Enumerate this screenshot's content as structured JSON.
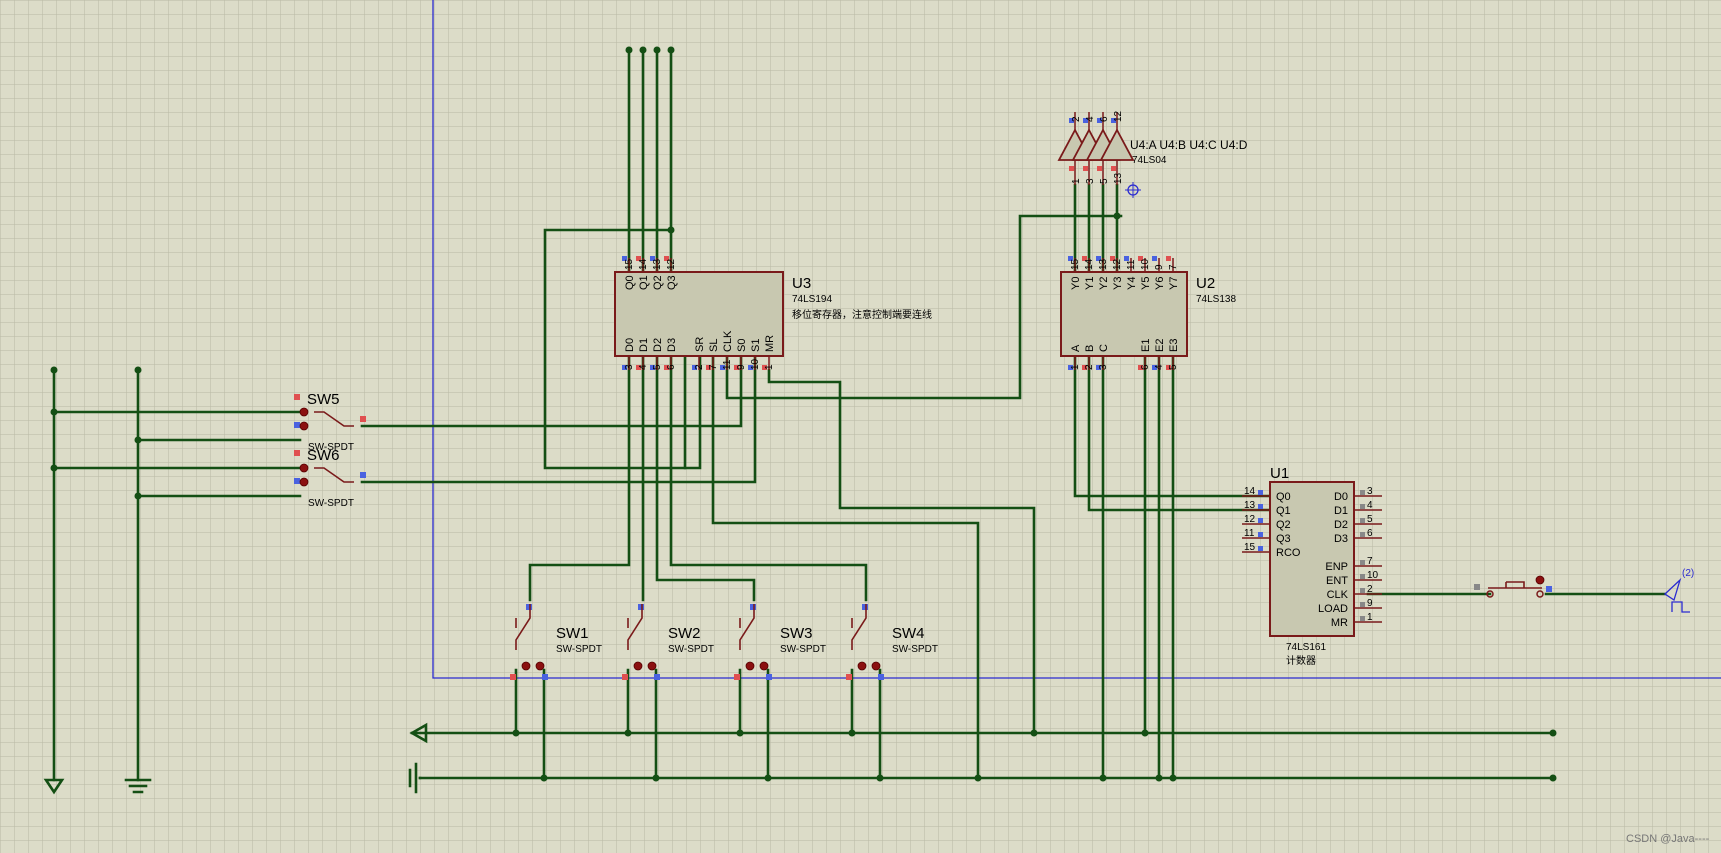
{
  "watermark": "CSDN @Java----",
  "u3": {
    "ref": "U3",
    "part": "74LS194",
    "desc": "移位寄存器，注意控制端要连线",
    "top": [
      {
        "l": "Q0",
        "n": "15"
      },
      {
        "l": "Q1",
        "n": "14"
      },
      {
        "l": "Q2",
        "n": "13"
      },
      {
        "l": "Q3",
        "n": "12"
      }
    ],
    "bottom": [
      {
        "l": "D0",
        "n": "3"
      },
      {
        "l": "D1",
        "n": "4"
      },
      {
        "l": "D2",
        "n": "5"
      },
      {
        "l": "D3",
        "n": "6"
      },
      {
        "l": "SR",
        "n": "2"
      },
      {
        "l": "SL",
        "n": "7"
      },
      {
        "l": "CLK",
        "n": "11"
      },
      {
        "l": "S0",
        "n": "9"
      },
      {
        "l": "S1",
        "n": "10"
      },
      {
        "l": "MR",
        "n": "1"
      }
    ]
  },
  "u2": {
    "ref": "U2",
    "part": "74LS138",
    "top": [
      {
        "l": "Y0",
        "n": "15"
      },
      {
        "l": "Y1",
        "n": "14"
      },
      {
        "l": "Y2",
        "n": "13"
      },
      {
        "l": "Y3",
        "n": "12"
      },
      {
        "l": "Y4",
        "n": "11"
      },
      {
        "l": "Y5",
        "n": "10"
      },
      {
        "l": "Y6",
        "n": "9"
      },
      {
        "l": "Y7",
        "n": "7"
      }
    ],
    "bottom": [
      {
        "l": "A",
        "n": "1"
      },
      {
        "l": "B",
        "n": "2"
      },
      {
        "l": "C",
        "n": "3"
      },
      {
        "l": "E1",
        "n": "6"
      },
      {
        "l": "E2",
        "n": "4"
      },
      {
        "l": "E3",
        "n": "5"
      }
    ]
  },
  "u1": {
    "ref": "U1",
    "part": "74LS161",
    "desc": "计数器",
    "left": [
      {
        "l": "Q0",
        "n": "14"
      },
      {
        "l": "Q1",
        "n": "13"
      },
      {
        "l": "Q2",
        "n": "12"
      },
      {
        "l": "Q3",
        "n": "11"
      },
      {
        "l": "RCO",
        "n": "15"
      }
    ],
    "right": [
      {
        "l": "D0",
        "n": "3"
      },
      {
        "l": "D1",
        "n": "4"
      },
      {
        "l": "D2",
        "n": "5"
      },
      {
        "l": "D3",
        "n": "6"
      },
      {
        "l": "ENP",
        "n": "7"
      },
      {
        "l": "ENT",
        "n": "10"
      },
      {
        "l": "CLK",
        "n": "2"
      },
      {
        "l": "LOAD",
        "n": "9"
      },
      {
        "l": "MR",
        "n": "1"
      }
    ]
  },
  "inverters": {
    "label": "U4:A U4:B U4:C U4:D",
    "part": "74LS04",
    "top_pins": [
      "2",
      "4",
      "6",
      "12"
    ],
    "bottom_pins": [
      "1",
      "3",
      "5",
      "13"
    ]
  },
  "switches": [
    {
      "ref": "SW1",
      "part": "SW-SPDT"
    },
    {
      "ref": "SW2",
      "part": "SW-SPDT"
    },
    {
      "ref": "SW3",
      "part": "SW-SPDT"
    },
    {
      "ref": "SW4",
      "part": "SW-SPDT"
    },
    {
      "ref": "SW5",
      "part": "SW-SPDT"
    },
    {
      "ref": "SW6",
      "part": "SW-SPDT"
    }
  ],
  "clock_label": "(2)"
}
